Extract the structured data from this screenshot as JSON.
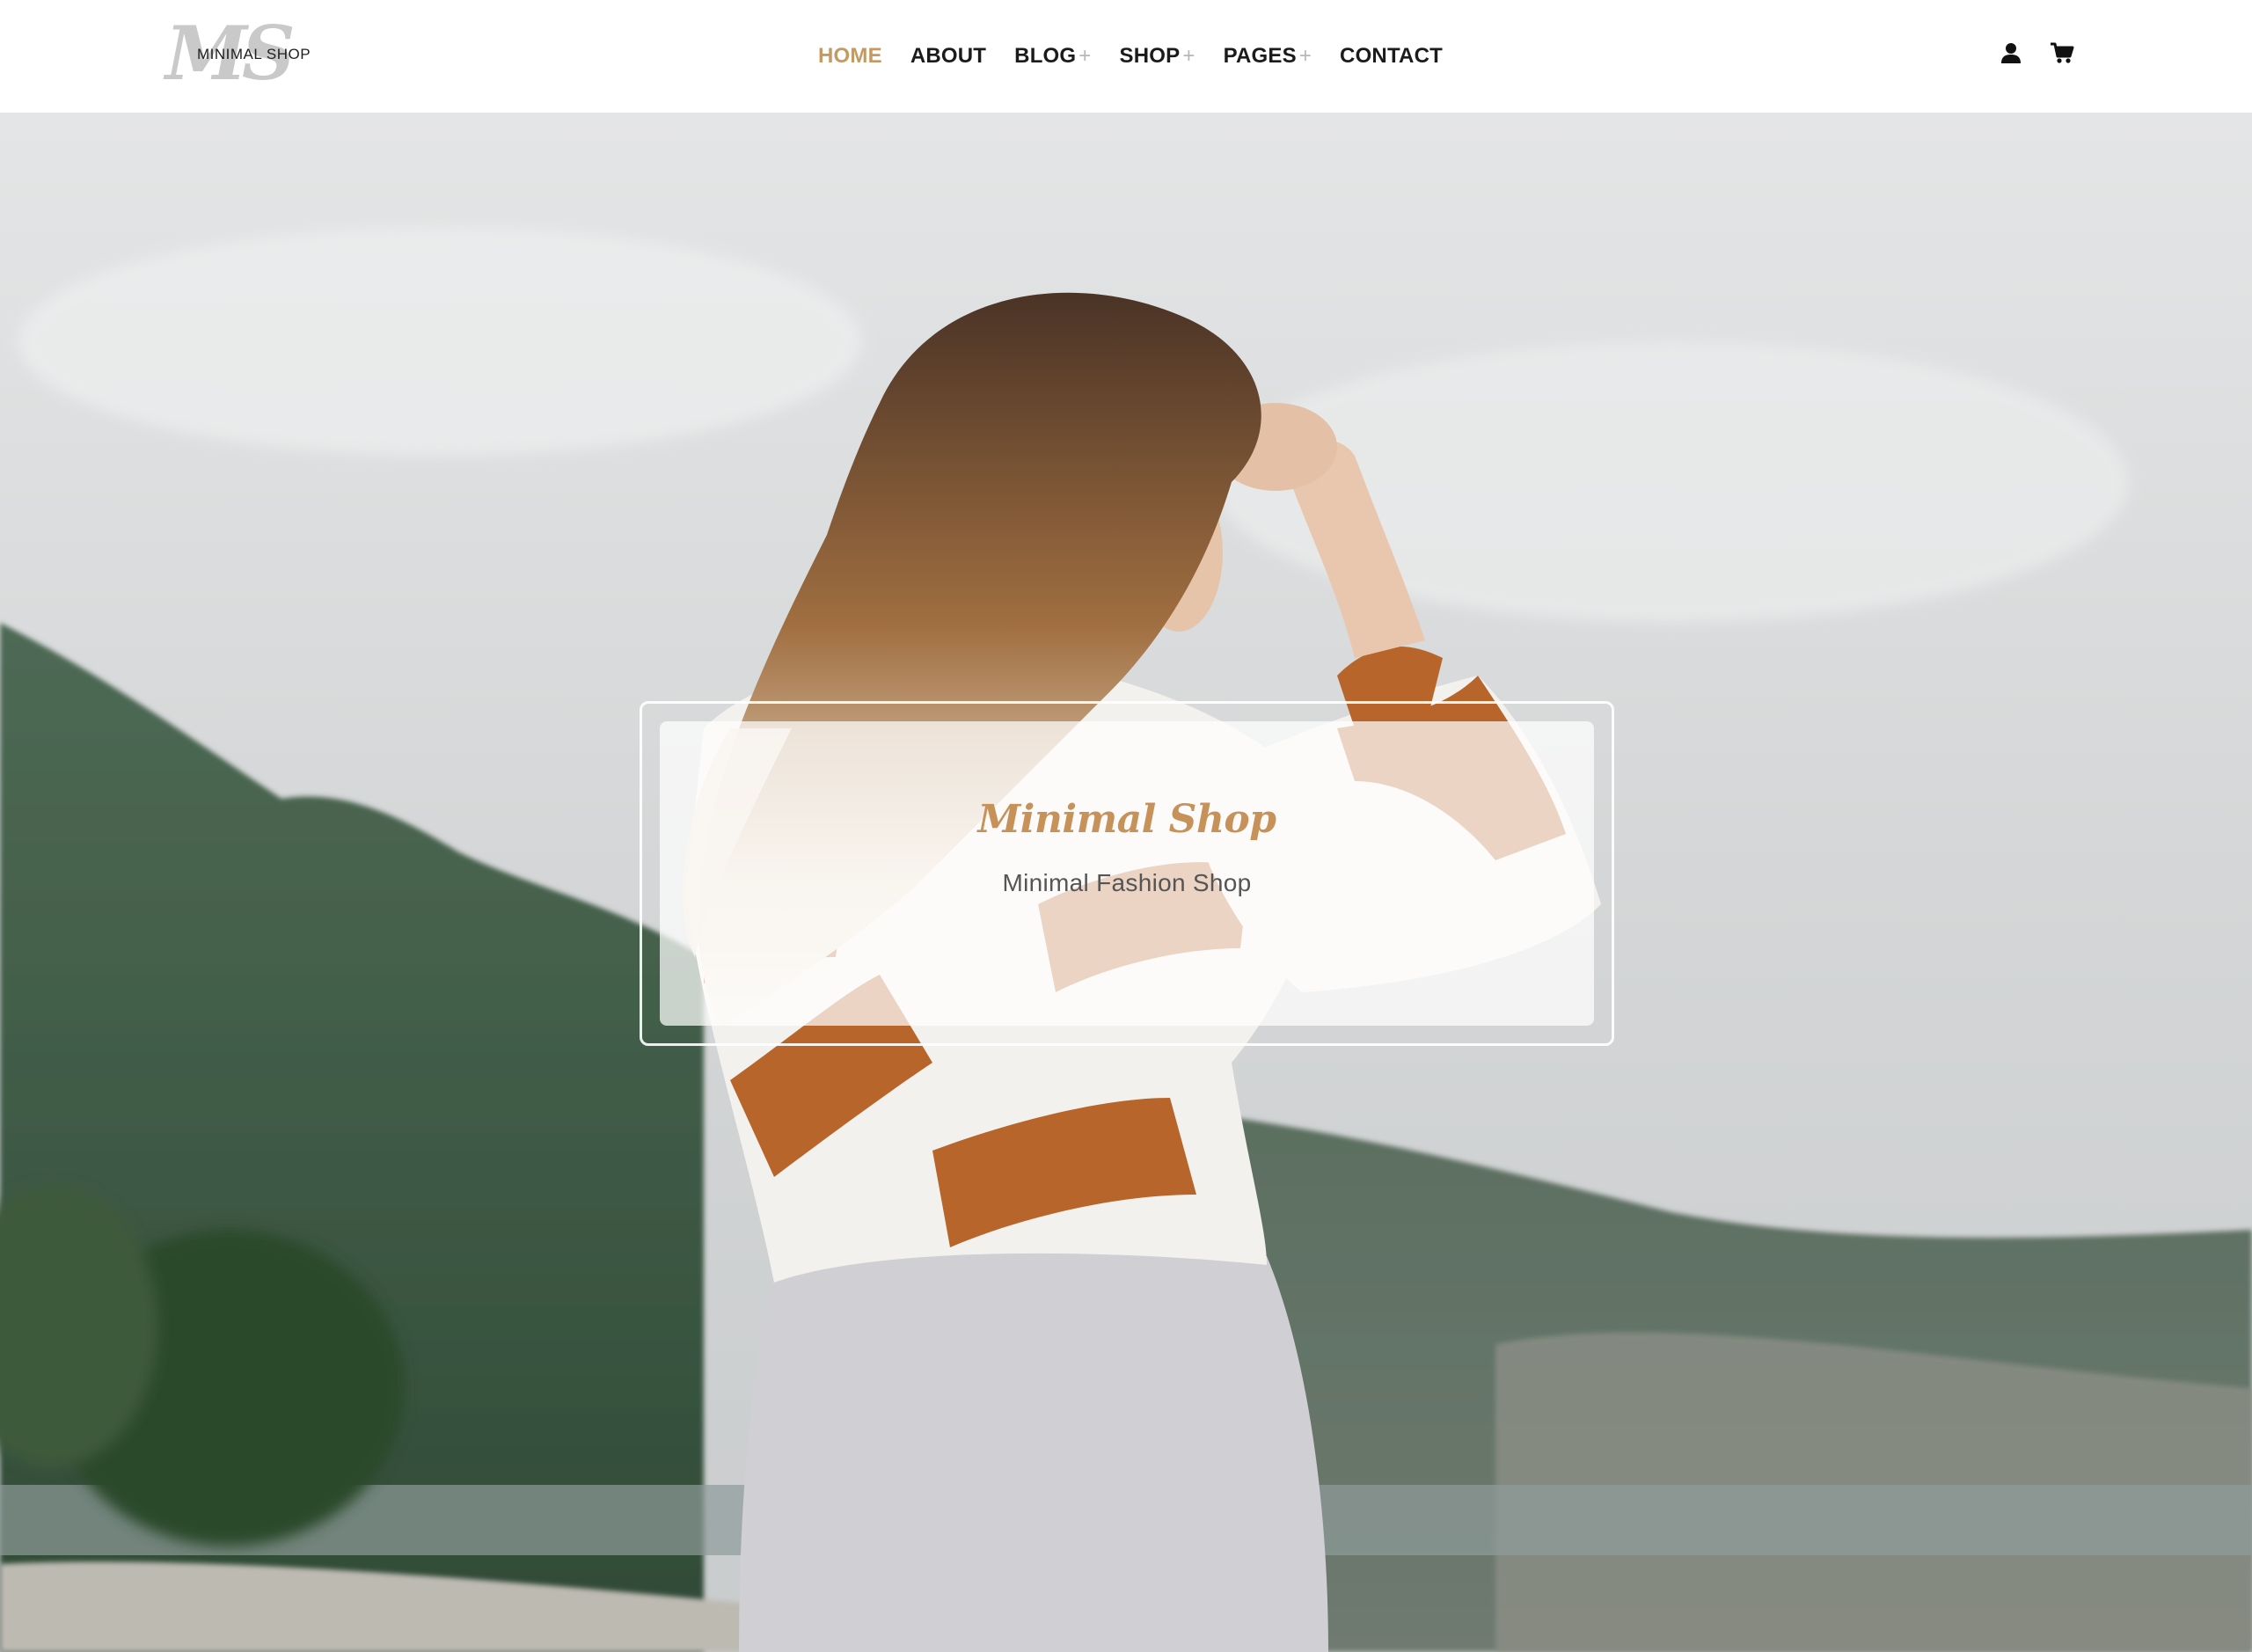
{
  "brand": {
    "logo_mark": "MS",
    "logo_text": "MINIMAL SHOP"
  },
  "nav": {
    "items": [
      {
        "label": "HOME",
        "active": true,
        "has_submenu": false
      },
      {
        "label": "ABOUT",
        "active": false,
        "has_submenu": false
      },
      {
        "label": "BLOG",
        "active": false,
        "has_submenu": true
      },
      {
        "label": "SHOP",
        "active": false,
        "has_submenu": true
      },
      {
        "label": "PAGES",
        "active": false,
        "has_submenu": true
      },
      {
        "label": "CONTACT",
        "active": false,
        "has_submenu": false
      }
    ],
    "submenu_indicator": "+"
  },
  "header_icons": {
    "account": "user-icon",
    "cart": "cart-icon"
  },
  "hero": {
    "title": "Minimal Shop",
    "subtitle": "Minimal Fashion Shop"
  },
  "colors": {
    "accent": "#c39a64",
    "title": "#c7925a",
    "nav_text": "#1b1b1b",
    "plus": "#b7b7b7"
  }
}
